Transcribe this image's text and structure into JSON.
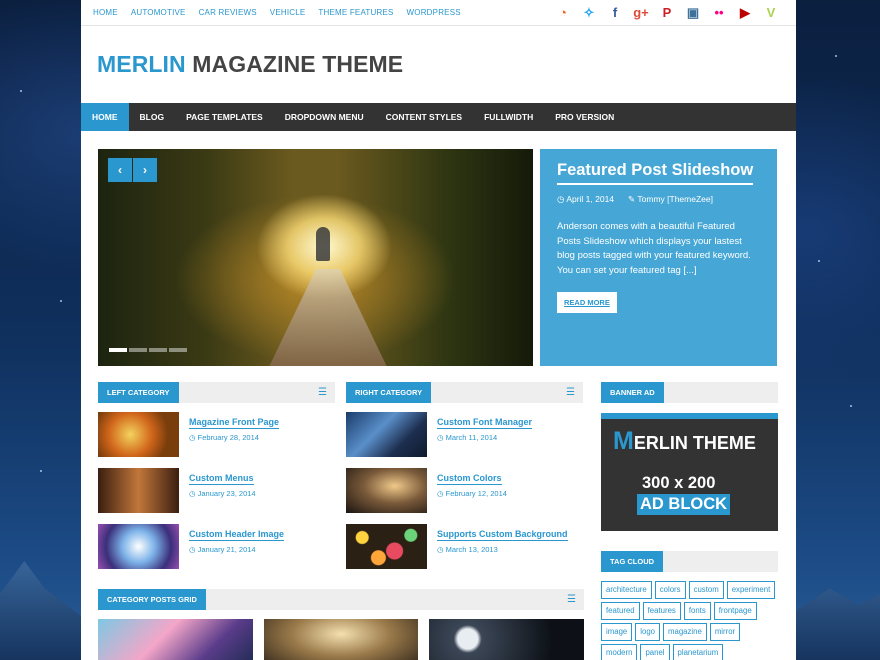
{
  "topnav": [
    "HOME",
    "AUTOMOTIVE",
    "CAR REVIEWS",
    "VEHICLE",
    "THEME FEATURES",
    "WORDPRESS"
  ],
  "social": [
    {
      "icon": "rss-icon",
      "glyph": "◔",
      "color": "#f26522"
    },
    {
      "icon": "twitter-icon",
      "glyph": "✧",
      "color": "#1da1f2"
    },
    {
      "icon": "facebook-icon",
      "glyph": "f",
      "color": "#3b5998"
    },
    {
      "icon": "google-plus-icon",
      "glyph": "g+",
      "color": "#dd4b39"
    },
    {
      "icon": "pinterest-icon",
      "glyph": "P",
      "color": "#cb2027"
    },
    {
      "icon": "instagram-icon",
      "glyph": "▣",
      "color": "#3f729b"
    },
    {
      "icon": "flickr-icon",
      "glyph": "••",
      "color": "#ff0084"
    },
    {
      "icon": "youtube-icon",
      "glyph": "▶",
      "color": "#bb0000"
    },
    {
      "icon": "vimeo-icon",
      "glyph": "V",
      "color": "#aad450"
    }
  ],
  "logo": {
    "part1": "MERLIN",
    "part2": " MAGAZINE THEME"
  },
  "mainnav": [
    "HOME",
    "BLOG",
    "PAGE TEMPLATES",
    "DROPDOWN MENU",
    "CONTENT STYLES",
    "FULLWIDTH",
    "PRO VERSION"
  ],
  "slider": {
    "title": "Featured Post Slideshow",
    "date": "April 1, 2014",
    "author": "Tommy [ThemeZee]",
    "excerpt": "Anderson comes with a beautiful Featured Posts Slideshow which displays your lastest blog posts tagged with your featured keyword. You can set your featured tag [...]",
    "readmore": "READ MORE",
    "prev": "‹",
    "next": "›"
  },
  "left": {
    "title": "LEFT CATEGORY",
    "posts": [
      {
        "title": "Magazine Front Page",
        "date": "February 28, 2014"
      },
      {
        "title": "Custom Menus",
        "date": "January 23, 2014"
      },
      {
        "title": "Custom Header Image",
        "date": "January 21, 2014"
      }
    ]
  },
  "right": {
    "title": "RIGHT CATEGORY",
    "posts": [
      {
        "title": "Custom Font Manager",
        "date": "March 11, 2014"
      },
      {
        "title": "Custom Colors",
        "date": "February 12, 2014"
      },
      {
        "title": "Supports Custom Background",
        "date": "March 13, 2013"
      }
    ]
  },
  "banner": {
    "title": "BANNER AD",
    "m": "M",
    "line1": "ERLIN THEME",
    "line2": "300 x 200",
    "line3": "AD BLOCK"
  },
  "tagcloud": {
    "title": "TAG CLOUD",
    "tags": [
      "architecture",
      "colors",
      "custom",
      "experiment",
      "featured",
      "features",
      "fonts",
      "frontpage",
      "image",
      "logo",
      "magazine",
      "mirror",
      "modern",
      "panel",
      "planetarium"
    ]
  },
  "grid": {
    "title": "CATEGORY POSTS GRID"
  },
  "colors": {
    "accent": "#2a97cf",
    "nav": "#333333"
  }
}
